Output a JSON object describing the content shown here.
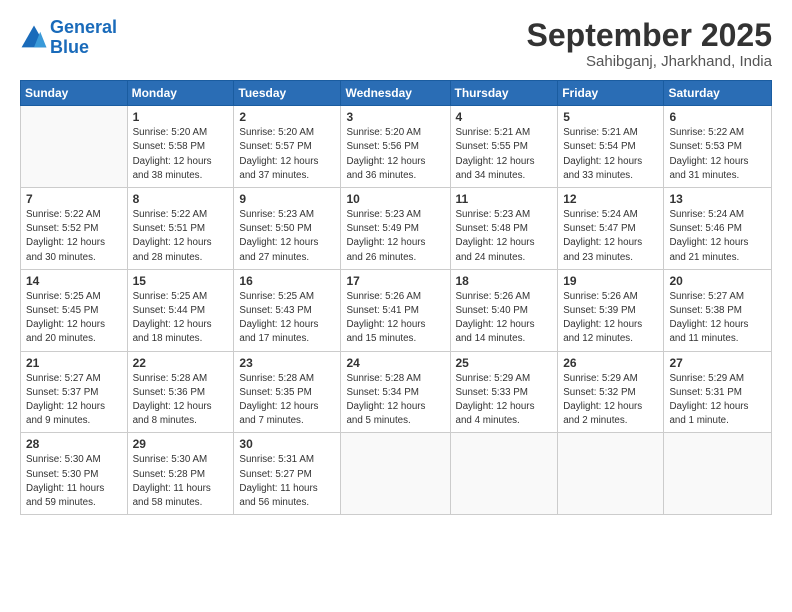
{
  "header": {
    "logo_line1": "General",
    "logo_line2": "Blue",
    "month_title": "September 2025",
    "subtitle": "Sahibganj, Jharkhand, India"
  },
  "days_of_week": [
    "Sunday",
    "Monday",
    "Tuesday",
    "Wednesday",
    "Thursday",
    "Friday",
    "Saturday"
  ],
  "weeks": [
    [
      {
        "day": "",
        "info": ""
      },
      {
        "day": "1",
        "info": "Sunrise: 5:20 AM\nSunset: 5:58 PM\nDaylight: 12 hours\nand 38 minutes."
      },
      {
        "day": "2",
        "info": "Sunrise: 5:20 AM\nSunset: 5:57 PM\nDaylight: 12 hours\nand 37 minutes."
      },
      {
        "day": "3",
        "info": "Sunrise: 5:20 AM\nSunset: 5:56 PM\nDaylight: 12 hours\nand 36 minutes."
      },
      {
        "day": "4",
        "info": "Sunrise: 5:21 AM\nSunset: 5:55 PM\nDaylight: 12 hours\nand 34 minutes."
      },
      {
        "day": "5",
        "info": "Sunrise: 5:21 AM\nSunset: 5:54 PM\nDaylight: 12 hours\nand 33 minutes."
      },
      {
        "day": "6",
        "info": "Sunrise: 5:22 AM\nSunset: 5:53 PM\nDaylight: 12 hours\nand 31 minutes."
      }
    ],
    [
      {
        "day": "7",
        "info": "Sunrise: 5:22 AM\nSunset: 5:52 PM\nDaylight: 12 hours\nand 30 minutes."
      },
      {
        "day": "8",
        "info": "Sunrise: 5:22 AM\nSunset: 5:51 PM\nDaylight: 12 hours\nand 28 minutes."
      },
      {
        "day": "9",
        "info": "Sunrise: 5:23 AM\nSunset: 5:50 PM\nDaylight: 12 hours\nand 27 minutes."
      },
      {
        "day": "10",
        "info": "Sunrise: 5:23 AM\nSunset: 5:49 PM\nDaylight: 12 hours\nand 26 minutes."
      },
      {
        "day": "11",
        "info": "Sunrise: 5:23 AM\nSunset: 5:48 PM\nDaylight: 12 hours\nand 24 minutes."
      },
      {
        "day": "12",
        "info": "Sunrise: 5:24 AM\nSunset: 5:47 PM\nDaylight: 12 hours\nand 23 minutes."
      },
      {
        "day": "13",
        "info": "Sunrise: 5:24 AM\nSunset: 5:46 PM\nDaylight: 12 hours\nand 21 minutes."
      }
    ],
    [
      {
        "day": "14",
        "info": "Sunrise: 5:25 AM\nSunset: 5:45 PM\nDaylight: 12 hours\nand 20 minutes."
      },
      {
        "day": "15",
        "info": "Sunrise: 5:25 AM\nSunset: 5:44 PM\nDaylight: 12 hours\nand 18 minutes."
      },
      {
        "day": "16",
        "info": "Sunrise: 5:25 AM\nSunset: 5:43 PM\nDaylight: 12 hours\nand 17 minutes."
      },
      {
        "day": "17",
        "info": "Sunrise: 5:26 AM\nSunset: 5:41 PM\nDaylight: 12 hours\nand 15 minutes."
      },
      {
        "day": "18",
        "info": "Sunrise: 5:26 AM\nSunset: 5:40 PM\nDaylight: 12 hours\nand 14 minutes."
      },
      {
        "day": "19",
        "info": "Sunrise: 5:26 AM\nSunset: 5:39 PM\nDaylight: 12 hours\nand 12 minutes."
      },
      {
        "day": "20",
        "info": "Sunrise: 5:27 AM\nSunset: 5:38 PM\nDaylight: 12 hours\nand 11 minutes."
      }
    ],
    [
      {
        "day": "21",
        "info": "Sunrise: 5:27 AM\nSunset: 5:37 PM\nDaylight: 12 hours\nand 9 minutes."
      },
      {
        "day": "22",
        "info": "Sunrise: 5:28 AM\nSunset: 5:36 PM\nDaylight: 12 hours\nand 8 minutes."
      },
      {
        "day": "23",
        "info": "Sunrise: 5:28 AM\nSunset: 5:35 PM\nDaylight: 12 hours\nand 7 minutes."
      },
      {
        "day": "24",
        "info": "Sunrise: 5:28 AM\nSunset: 5:34 PM\nDaylight: 12 hours\nand 5 minutes."
      },
      {
        "day": "25",
        "info": "Sunrise: 5:29 AM\nSunset: 5:33 PM\nDaylight: 12 hours\nand 4 minutes."
      },
      {
        "day": "26",
        "info": "Sunrise: 5:29 AM\nSunset: 5:32 PM\nDaylight: 12 hours\nand 2 minutes."
      },
      {
        "day": "27",
        "info": "Sunrise: 5:29 AM\nSunset: 5:31 PM\nDaylight: 12 hours\nand 1 minute."
      }
    ],
    [
      {
        "day": "28",
        "info": "Sunrise: 5:30 AM\nSunset: 5:30 PM\nDaylight: 11 hours\nand 59 minutes."
      },
      {
        "day": "29",
        "info": "Sunrise: 5:30 AM\nSunset: 5:28 PM\nDaylight: 11 hours\nand 58 minutes."
      },
      {
        "day": "30",
        "info": "Sunrise: 5:31 AM\nSunset: 5:27 PM\nDaylight: 11 hours\nand 56 minutes."
      },
      {
        "day": "",
        "info": ""
      },
      {
        "day": "",
        "info": ""
      },
      {
        "day": "",
        "info": ""
      },
      {
        "day": "",
        "info": ""
      }
    ]
  ]
}
